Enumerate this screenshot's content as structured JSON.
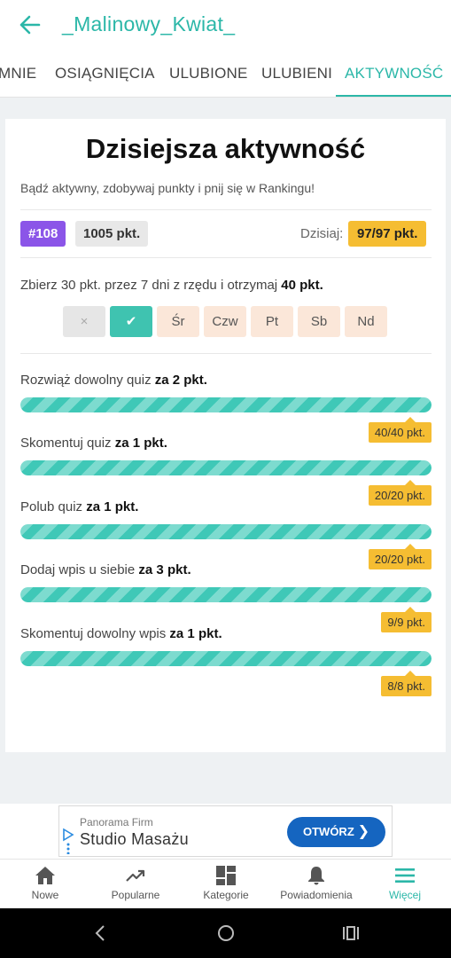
{
  "header": {
    "title": "_Malinowy_Kwiat_"
  },
  "tabs": [
    {
      "label": "MNIE"
    },
    {
      "label": "OSIĄGNIĘCIA"
    },
    {
      "label": "ULUBIONE"
    },
    {
      "label": "ULUBIENI"
    },
    {
      "label": "AKTYWNOŚĆ",
      "active": true
    }
  ],
  "activity": {
    "title": "Dzisiejsza aktywność",
    "subtitle": "Bądź aktywny, zdobywaj punkty i pnij się w Rankingu!",
    "rank": "#108",
    "points": "1005 pkt.",
    "today_label": "Dzisiaj:",
    "today_value": "97/97 pkt.",
    "streak_text": "Zbierz 30 pkt. przez 7 dni z rzędu i otrzymaj",
    "streak_bonus": "40 pkt.",
    "days": [
      {
        "label": "×",
        "state": "missed"
      },
      {
        "label": "✔",
        "state": "done"
      },
      {
        "label": "Śr",
        "state": "future"
      },
      {
        "label": "Czw",
        "state": "future"
      },
      {
        "label": "Pt",
        "state": "future"
      },
      {
        "label": "Sb",
        "state": "future"
      },
      {
        "label": "Nd",
        "state": "future"
      }
    ],
    "tasks": [
      {
        "text": "Rozwiąż dowolny quiz",
        "reward": "za 2 pkt.",
        "progress": "40/40 pkt.",
        "fraction": 1.0
      },
      {
        "text": "Skomentuj quiz",
        "reward": "za 1 pkt.",
        "progress": "20/20 pkt.",
        "fraction": 1.0
      },
      {
        "text": "Polub quiz",
        "reward": "za 1 pkt.",
        "progress": "20/20 pkt.",
        "fraction": 1.0
      },
      {
        "text": "Dodaj wpis u siebie",
        "reward": "za 3 pkt.",
        "progress": "9/9 pkt.",
        "fraction": 1.0
      },
      {
        "text": "Skomentuj dowolny wpis",
        "reward": "za 1 pkt.",
        "progress": "8/8 pkt.",
        "fraction": 1.0
      }
    ]
  },
  "ad": {
    "brand": "Panorama Firm",
    "name": "Studio Masażu",
    "button": "OTWÓRZ"
  },
  "bottom_nav": [
    {
      "label": "Nowe",
      "icon": "home-icon"
    },
    {
      "label": "Popularne",
      "icon": "trending-icon"
    },
    {
      "label": "Kategorie",
      "icon": "grid-icon"
    },
    {
      "label": "Powiadomienia",
      "icon": "bell-icon"
    },
    {
      "label": "Więcej",
      "icon": "menu-icon",
      "active": true
    }
  ],
  "colors": {
    "accent": "#2bb7a8",
    "rank": "#8b55e8",
    "highlight": "#f5bd32",
    "ad_button": "#1565c0"
  }
}
